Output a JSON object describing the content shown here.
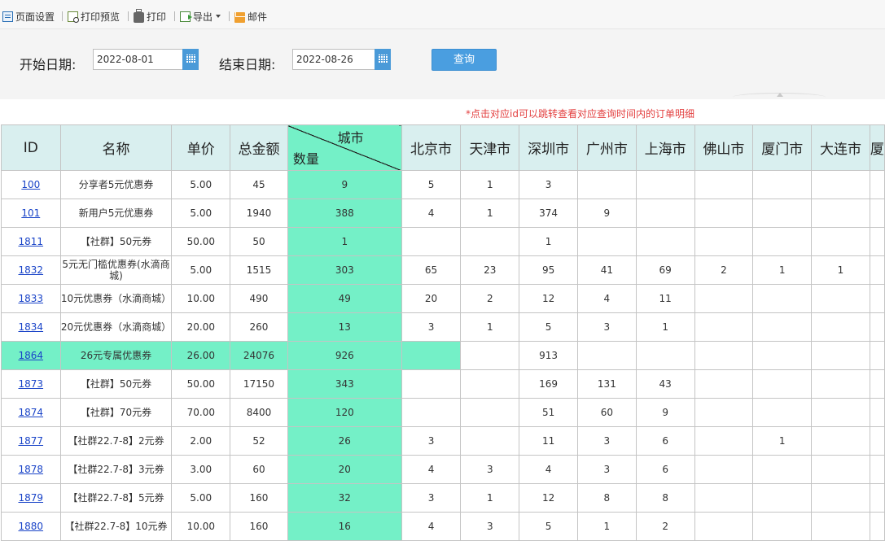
{
  "toolbar": {
    "page_setup": "页面设置",
    "print_preview": "打印预览",
    "print": "打印",
    "export": "导出",
    "mail": "邮件"
  },
  "filter": {
    "start_label": "开始日期:",
    "start_value": "2022-08-01",
    "end_label": "结束日期:",
    "end_value": "2022-08-26",
    "query_label": "查询"
  },
  "note": "*点击对应id可以跳转查看对应查询时间内的订单明细",
  "table": {
    "headers": {
      "id": "ID",
      "name": "名称",
      "price": "单价",
      "total": "总金额",
      "city": "城市",
      "qty": "数量",
      "cities": [
        "北京市",
        "天津市",
        "深圳市",
        "广州市",
        "上海市",
        "佛山市",
        "厦门市",
        "大连市",
        "厦"
      ]
    },
    "rows": [
      {
        "id": "100",
        "name": "分享者5元优惠券",
        "price": "5.00",
        "total": "45",
        "qty": "9",
        "cities": [
          "5",
          "1",
          "3",
          "",
          "",
          "",
          "",
          "",
          ""
        ]
      },
      {
        "id": "101",
        "name": "新用户5元优惠券",
        "price": "5.00",
        "total": "1940",
        "qty": "388",
        "cities": [
          "4",
          "1",
          "374",
          "9",
          "",
          "",
          "",
          "",
          ""
        ]
      },
      {
        "id": "1811",
        "name": "【社群】50元券",
        "price": "50.00",
        "total": "50",
        "qty": "1",
        "cities": [
          "",
          "",
          "1",
          "",
          "",
          "",
          "",
          "",
          ""
        ]
      },
      {
        "id": "1832",
        "name": "5元无门槛优惠券(水滴商城)",
        "price": "5.00",
        "total": "1515",
        "qty": "303",
        "cities": [
          "65",
          "23",
          "95",
          "41",
          "69",
          "2",
          "1",
          "1",
          ""
        ]
      },
      {
        "id": "1833",
        "name": "10元优惠券（水滴商城）",
        "price": "10.00",
        "total": "490",
        "qty": "49",
        "cities": [
          "20",
          "2",
          "12",
          "4",
          "11",
          "",
          "",
          "",
          ""
        ]
      },
      {
        "id": "1834",
        "name": "20元优惠券（水滴商城）",
        "price": "20.00",
        "total": "260",
        "qty": "13",
        "cities": [
          "3",
          "1",
          "5",
          "3",
          "1",
          "",
          "",
          "",
          ""
        ]
      },
      {
        "id": "1864",
        "name": "26元专属优惠券",
        "price": "26.00",
        "total": "24076",
        "qty": "926",
        "cities": [
          "",
          "",
          "913",
          "",
          "",
          "",
          "",
          "",
          ""
        ],
        "highlight": true
      },
      {
        "id": "1873",
        "name": "【社群】50元券",
        "price": "50.00",
        "total": "17150",
        "qty": "343",
        "cities": [
          "",
          "",
          "169",
          "131",
          "43",
          "",
          "",
          "",
          ""
        ]
      },
      {
        "id": "1874",
        "name": "【社群】70元券",
        "price": "70.00",
        "total": "8400",
        "qty": "120",
        "cities": [
          "",
          "",
          "51",
          "60",
          "9",
          "",
          "",
          "",
          ""
        ]
      },
      {
        "id": "1877",
        "name": "【社群22.7-8】2元券",
        "price": "2.00",
        "total": "52",
        "qty": "26",
        "cities": [
          "3",
          "",
          "11",
          "3",
          "6",
          "",
          "1",
          "",
          ""
        ]
      },
      {
        "id": "1878",
        "name": "【社群22.7-8】3元券",
        "price": "3.00",
        "total": "60",
        "qty": "20",
        "cities": [
          "4",
          "3",
          "4",
          "3",
          "6",
          "",
          "",
          "",
          ""
        ]
      },
      {
        "id": "1879",
        "name": "【社群22.7-8】5元券",
        "price": "5.00",
        "total": "160",
        "qty": "32",
        "cities": [
          "3",
          "1",
          "12",
          "8",
          "8",
          "",
          "",
          "",
          ""
        ]
      },
      {
        "id": "1880",
        "name": "【社群22.7-8】10元券",
        "price": "10.00",
        "total": "160",
        "qty": "16",
        "cities": [
          "4",
          "3",
          "5",
          "1",
          "2",
          "",
          "",
          "",
          ""
        ]
      }
    ]
  },
  "colors": {
    "highlight": "#74f0c7",
    "header_bg": "#d9efef",
    "link": "#1a44c8",
    "note": "#e34040",
    "query_button": "#4a9ee0"
  }
}
